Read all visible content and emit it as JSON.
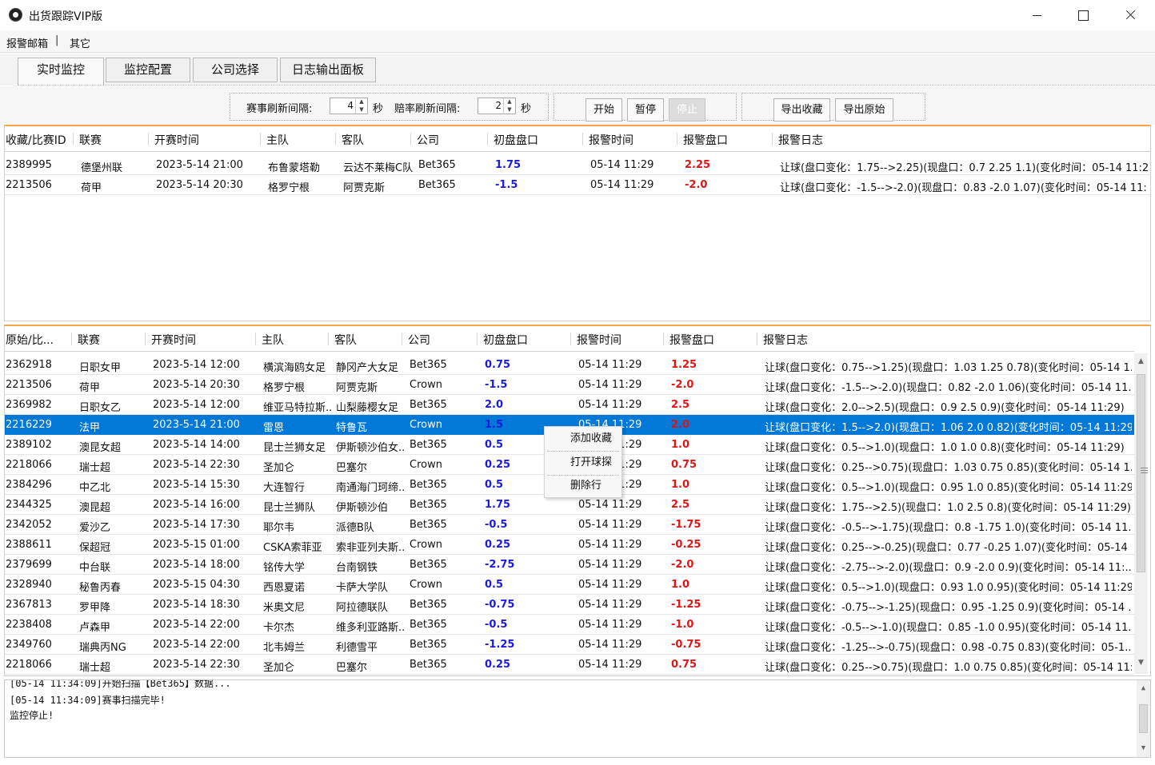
{
  "window": {
    "title": "出货跟踪VIP版"
  },
  "menu": {
    "items": [
      "报警邮箱",
      "其它"
    ],
    "separator": "|"
  },
  "tabs": [
    "实时监控",
    "监控配置",
    "公司选择",
    "日志输出面板"
  ],
  "toolbar": {
    "match_refresh_label": "赛事刷新间隔:",
    "match_refresh_value": "4",
    "odds_refresh_label": "赔率刷新间隔:",
    "odds_refresh_value": "2",
    "unit": "秒",
    "start": "开始",
    "pause": "暂停",
    "stop": "停止",
    "export_fav": "导出收藏",
    "export_orig": "导出原始"
  },
  "fav_table": {
    "headers": [
      "收藏/比赛ID",
      "联赛",
      "开赛时间",
      "主队",
      "客队",
      "公司",
      "初盘盘口",
      "报警时间",
      "报警盘口",
      "报警日志"
    ],
    "rows": [
      [
        "2389995",
        "德堡州联",
        "2023-5-14 21:00",
        "布鲁蒙塔勒",
        "云达不莱梅C队",
        "Bet365",
        "1.75",
        "05-14 11:29",
        "2.25",
        "让球(盘口变化：1.75-->2.25)(现盘口：0.7  2.25  1.1)(变化时间：05-14 11:29)"
      ],
      [
        "2213506",
        "荷甲",
        "2023-5-14 20:30",
        "格罗宁根",
        "阿贾克斯",
        "Bet365",
        "-1.5",
        "05-14 11:29",
        "-2.0",
        "让球(盘口变化：-1.5-->-2.0)(现盘口：0.83  -2.0  1.07)(变化时间：05-14 11:..."
      ]
    ]
  },
  "orig_table": {
    "headers": [
      "原始/比...",
      "联赛",
      "开赛时间",
      "主队",
      "客队",
      "公司",
      "初盘盘口",
      "报警时间",
      "报警盘口",
      "报警日志"
    ],
    "selected_index": 3,
    "rows": [
      [
        "2362918",
        "日职女甲",
        "2023-5-14 12:00",
        "横滨海鸥女足",
        "静冈产大女足",
        "Bet365",
        "0.75",
        "05-14 11:29",
        "1.25",
        "让球(盘口变化：0.75-->1.25)(现盘口：1.03  1.25  0.78)(变化时间：05-14 1..."
      ],
      [
        "2213506",
        "荷甲",
        "2023-5-14 20:30",
        "格罗宁根",
        "阿贾克斯",
        "Crown",
        "-1.5",
        "05-14 11:29",
        "-2.0",
        "让球(盘口变化：-1.5-->-2.0)(现盘口：0.82  -2.0  1.06)(变化时间：05-14 11..."
      ],
      [
        "2369982",
        "日职女乙",
        "2023-5-14 12:00",
        "维亚马特拉斯...",
        "山梨藤樱女足",
        "Bet365",
        "2.0",
        "05-14 11:29",
        "2.5",
        "让球(盘口变化：2.0-->2.5)(现盘口：0.9  2.5  0.9)(变化时间：05-14 11:29)"
      ],
      [
        "2216229",
        "法甲",
        "2023-5-14 21:00",
        "雷恩",
        "特鲁瓦",
        "Crown",
        "1.5",
        "05-14 11:29",
        "2.0",
        "让球(盘口变化：1.5-->2.0)(现盘口：1.06  2.0  0.82)(变化时间：05-14 11:29)"
      ],
      [
        "2389102",
        "澳昆女超",
        "2023-5-14 14:00",
        "昆士兰狮女足",
        "伊斯顿沙伯女...",
        "Bet365",
        "0.5",
        "05-14 11:29",
        "1.0",
        "让球(盘口变化：0.5-->1.0)(现盘口：1.0  1.0  0.8)(变化时间：05-14 11:29)"
      ],
      [
        "2218066",
        "瑞士超",
        "2023-5-14 22:30",
        "圣加仑",
        "巴塞尔",
        "Crown",
        "0.25",
        "05-14 11:29",
        "0.75",
        "让球(盘口变化：0.25-->0.75)(现盘口：1.03  0.75  0.85)(变化时间：05-14 1..."
      ],
      [
        "2384296",
        "中乙北",
        "2023-5-14 15:30",
        "大连智行",
        "南通海门珂缔...",
        "Bet365",
        "0.5",
        "05-14 11:29",
        "1.0",
        "让球(盘口变化：0.5-->1.0)(现盘口：0.95  1.0  0.85)(变化时间：05-14 11:29)"
      ],
      [
        "2344325",
        "澳昆超",
        "2023-5-14 16:00",
        "昆士兰狮队",
        "伊斯顿沙伯",
        "Bet365",
        "1.75",
        "05-14 11:29",
        "2.5",
        "让球(盘口变化：1.75-->2.5)(现盘口：1.0  2.5  0.8)(变化时间：05-14 11:29)"
      ],
      [
        "2342052",
        "爱沙乙",
        "2023-5-14 17:30",
        "耶尔韦",
        "派德B队",
        "Bet365",
        "-0.5",
        "05-14 11:29",
        "-1.75",
        "让球(盘口变化：-0.5-->-1.75)(现盘口：0.8  -1.75  1.0)(变化时间：05-14 11..."
      ],
      [
        "2388611",
        "保超冠",
        "2023-5-15 01:00",
        "CSKA索菲亚",
        "索非亚列夫斯...",
        "Crown",
        "0.25",
        "05-14 11:29",
        "-0.25",
        "让球(盘口变化：0.25-->-0.25)(现盘口：0.77  -0.25  1.07)(变化时间：05-14 ..."
      ],
      [
        "2379699",
        "中台联",
        "2023-5-14 18:00",
        "铭传大学",
        "台南钢铁",
        "Bet365",
        "-2.75",
        "05-14 11:29",
        "-2.0",
        "让球(盘口变化：-2.75-->-2.0)(现盘口：0.9  -2.0  0.9)(变化时间：05-14 11:..."
      ],
      [
        "2328940",
        "秘鲁丙春",
        "2023-5-15 04:30",
        "西恩夏诺",
        "卡萨大学队",
        "Crown",
        "0.5",
        "05-14 11:29",
        "1.0",
        "让球(盘口变化：0.5-->1.0)(现盘口：0.93  1.0  0.95)(变化时间：05-14 11:29)"
      ],
      [
        "2367813",
        "罗甲降",
        "2023-5-14 18:30",
        "米奥文尼",
        "阿拉德联队",
        "Bet365",
        "-0.75",
        "05-14 11:29",
        "-1.25",
        "让球(盘口变化：-0.75-->-1.25)(现盘口：0.95  -1.25  0.9)(变化时间：05-14 ..."
      ],
      [
        "2238408",
        "卢森甲",
        "2023-5-14 22:00",
        "卡尔杰",
        "维多利亚路斯...",
        "Bet365",
        "-0.5",
        "05-14 11:29",
        "-1.0",
        "让球(盘口变化：-0.5-->-1.0)(现盘口：0.85  -1.0  0.95)(变化时间：05-14 11..."
      ],
      [
        "2349760",
        "瑞典丙NG",
        "2023-5-14 22:00",
        "北韦姆兰",
        "利德雪平",
        "Bet365",
        "-1.25",
        "05-14 11:29",
        "-0.75",
        "让球(盘口变化：-1.25-->-0.75)(现盘口：0.98  -0.75  0.83)(变化时间：05-1..."
      ],
      [
        "2218066",
        "瑞士超",
        "2023-5-14 22:30",
        "圣加仑",
        "巴塞尔",
        "Bet365",
        "0.25",
        "05-14 11:29",
        "0.75",
        "让球(盘口变化：0.25-->0.75)(现盘口：1.0  0.75  0.85)(变化时间：05-14 11:..."
      ]
    ]
  },
  "context_menu": {
    "items": [
      "添加收藏",
      "打开球探",
      "删除行"
    ]
  },
  "log": {
    "lines": [
      "[05-14 11:34:09]开始扫描【Bet365】数据...",
      "[05-14 11:34:09]赛事扫描完毕!",
      "监控停止!"
    ]
  }
}
